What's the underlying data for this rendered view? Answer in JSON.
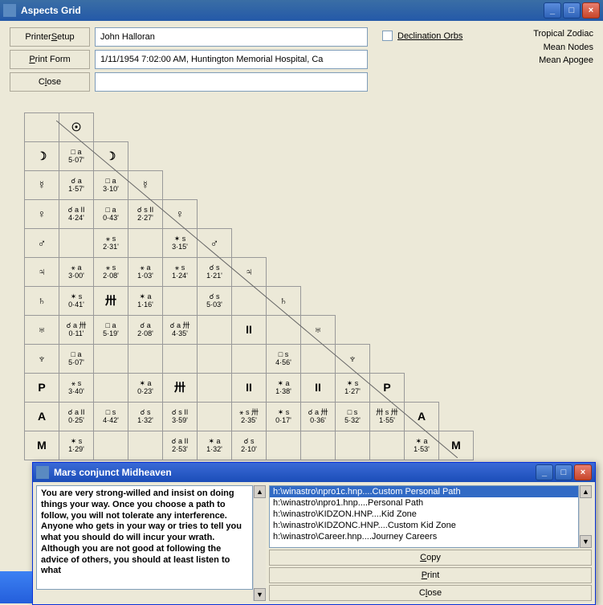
{
  "window": {
    "title": "Aspects Grid",
    "minimize": "_",
    "maximize": "□",
    "close": "×"
  },
  "toolbar": {
    "printer_setup": "Printer Setup",
    "print_form": "Print Form",
    "close": "Close",
    "name": "John Halloran",
    "details": "1/11/1954 7:02:00 AM, Huntington Memorial Hospital, Ca",
    "decl_orbs": "Declination Orbs"
  },
  "meta": {
    "line1": "Tropical Zodiac",
    "line2": "Mean Nodes",
    "line3": "Mean Apogee"
  },
  "planets": [
    "☉",
    "☽",
    "☿",
    "♀",
    "♂",
    "♃",
    "♄",
    "♅",
    "♆",
    "P",
    "A",
    "M"
  ],
  "grid": [
    [
      null,
      "☉"
    ],
    [
      "☽",
      {
        "a": "□ a",
        "o": "5·07'"
      },
      "☽"
    ],
    [
      "☿",
      {
        "a": "☌ a",
        "o": "1·57'"
      },
      {
        "a": "□ a",
        "o": "3·10'"
      },
      "☿"
    ],
    [
      "♀",
      {
        "a": "☌ a II",
        "o": "4·24'"
      },
      {
        "a": "□ a",
        "o": "0·43'"
      },
      {
        "a": "☌ s II",
        "o": "2·27'"
      },
      "♀"
    ],
    [
      "♂",
      null,
      {
        "a": "⚹ s",
        "o": "2·31'"
      },
      null,
      {
        "a": "✶ s",
        "o": "3·15'"
      },
      "♂"
    ],
    [
      "♃",
      {
        "a": "⚹ a",
        "o": "3·00'"
      },
      {
        "a": "⚹ s",
        "o": "2·08'"
      },
      {
        "a": "⚹ a",
        "o": "1·03'"
      },
      {
        "a": "⚹ s",
        "o": "1·24'"
      },
      {
        "a": "☌ s",
        "o": "1·21'"
      },
      "♃"
    ],
    [
      "♄",
      {
        "a": "✶ s",
        "o": "0·41'"
      },
      "卅",
      {
        "a": "✶ a",
        "o": "1·16'"
      },
      null,
      {
        "a": "☌ s",
        "o": "5·03'"
      },
      null,
      "♄"
    ],
    [
      "♅",
      {
        "a": "☌ a 卅",
        "o": "0·11'"
      },
      {
        "a": "□ a",
        "o": "5·19'"
      },
      {
        "a": "☌ a",
        "o": "2·08'"
      },
      {
        "a": "☌ a 卅",
        "o": "4·35'"
      },
      null,
      "II",
      null,
      "♅"
    ],
    [
      "♆",
      {
        "a": "□ a",
        "o": "5·07'"
      },
      null,
      null,
      null,
      null,
      null,
      {
        "a": "□ s",
        "o": "4·56'"
      },
      null,
      "♆"
    ],
    [
      "P",
      {
        "a": "⚹ s",
        "o": "3·40'"
      },
      null,
      {
        "a": "✶ a",
        "o": "0·23'"
      },
      "卅",
      null,
      "II",
      {
        "a": "✶ a",
        "o": "1·38'"
      },
      "II",
      {
        "a": "✶ s",
        "o": "1·27'"
      },
      "P"
    ],
    [
      "A",
      {
        "a": "☌ a II",
        "o": "0·25'"
      },
      {
        "a": "□ s",
        "o": "4·42'"
      },
      {
        "a": "☌ s",
        "o": "1·32'"
      },
      {
        "a": "☌ s II",
        "o": "3·59'"
      },
      null,
      {
        "a": "⚹ s 卅",
        "o": "2·35'"
      },
      {
        "a": "✶ s",
        "o": "0·17'"
      },
      {
        "a": "☌ a 卅",
        "o": "0·36'"
      },
      {
        "a": "□ s",
        "o": "5·32'"
      },
      {
        "a": "卅 s 卅",
        "o": "1·55'"
      },
      "A"
    ],
    [
      "M",
      {
        "a": "✶ s",
        "o": "1·29'"
      },
      null,
      null,
      {
        "a": "☌ a II",
        "o": "2·53'"
      },
      {
        "a": "✶ a",
        "o": "1·32'"
      },
      {
        "a": "☌ s",
        "o": "2·10'"
      },
      null,
      null,
      null,
      null,
      {
        "a": "✶ a",
        "o": "1·53'"
      },
      "M"
    ]
  ],
  "popup": {
    "title": "Mars conjunct Midheaven",
    "interpretation": "You are very strong-willed and insist on doing things your way.  Once you choose a path to follow, you will not tolerate any interference.  Anyone who gets in your way or tries to tell you what you should do will incur your wrath.  Although you are not good at following the advice of others, you should at least listen to what",
    "files": [
      {
        "path": "h:\\winastro\\npro1c.hnp",
        "desc": "Custom Personal Path",
        "sel": true
      },
      {
        "path": "h:\\winastro\\npro1.hnp",
        "desc": "Personal Path",
        "sel": false
      },
      {
        "path": "h:\\winastro\\KIDZON.HNP",
        "desc": "Kid Zone",
        "sel": false
      },
      {
        "path": "h:\\winastro\\KIDZONC.HNP",
        "desc": "Custom Kid Zone",
        "sel": false
      },
      {
        "path": "h:\\winastro\\Career.hnp",
        "desc": "Journey Careers",
        "sel": false
      }
    ],
    "copy": "Copy",
    "print": "Print",
    "close": "Close"
  }
}
